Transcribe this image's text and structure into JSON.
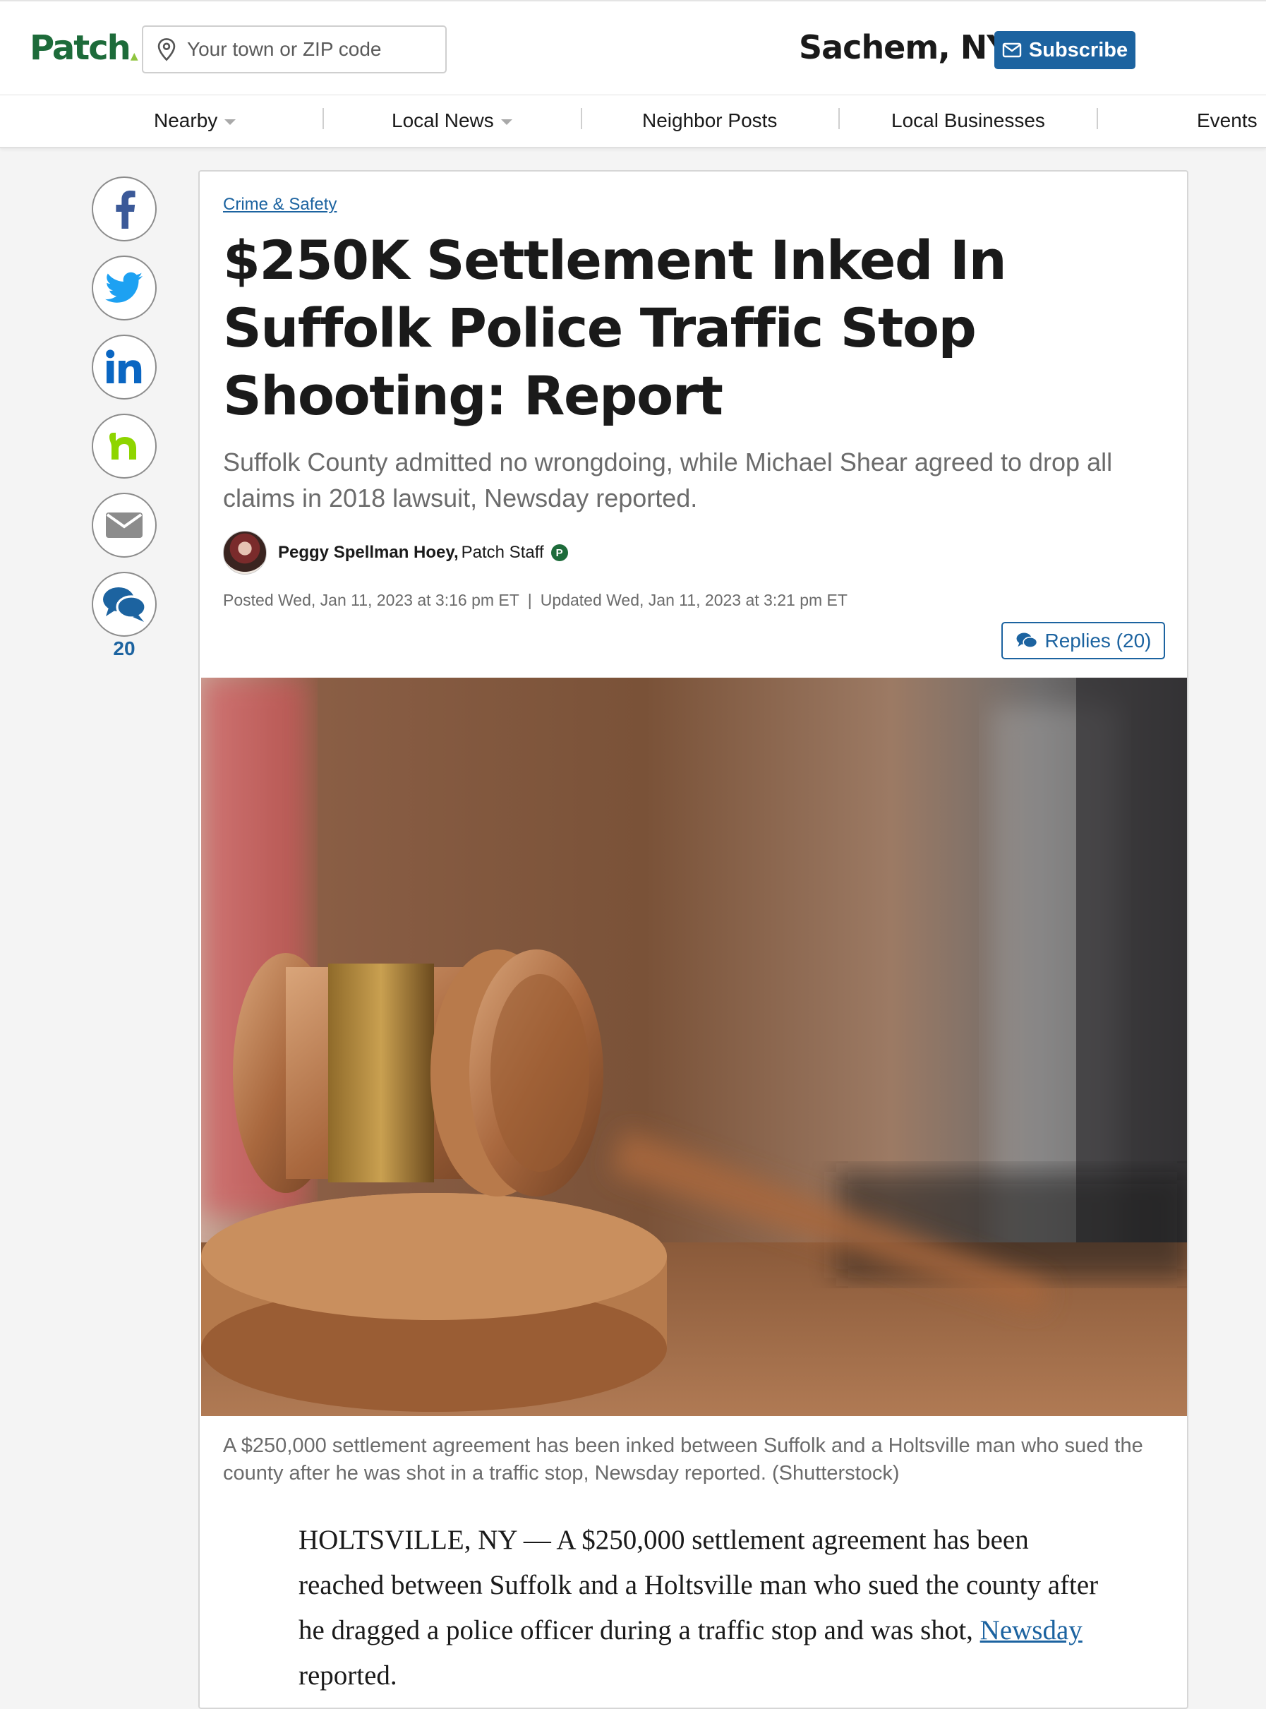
{
  "header": {
    "logo": "Patch",
    "search_placeholder": "Your town or ZIP code",
    "town": "Sachem, NY",
    "subscribe_label": "Subscribe"
  },
  "nav": {
    "items": [
      {
        "label": "Nearby",
        "dropdown": true
      },
      {
        "label": "Local News",
        "dropdown": true
      },
      {
        "label": "Neighbor Posts",
        "dropdown": false
      },
      {
        "label": "Local Businesses",
        "dropdown": false
      },
      {
        "label": "Events",
        "dropdown": false
      }
    ]
  },
  "share": {
    "icons": [
      "facebook-icon",
      "twitter-icon",
      "linkedin-icon",
      "nextdoor-icon",
      "email-icon",
      "comments-icon"
    ],
    "reply_count": "20"
  },
  "article": {
    "category": "Crime & Safety",
    "headline": "$250K Settlement Inked In Suffolk Police Traffic Stop Shooting: Report",
    "dek": "Suffolk County admitted no wrongdoing, while Michael Shear agreed to drop all claims in 2018 lawsuit, Newsday reported.",
    "author": "Peggy Spellman Hoey,",
    "author_role": "Patch Staff",
    "patch_badge": "P",
    "posted": "Posted Wed, Jan 11, 2023 at 3:16 pm ET",
    "date_separator": "|",
    "updated": "Updated Wed, Jan 11, 2023 at 3:21 pm ET",
    "replies_label": "Replies (20)",
    "caption": "A $250,000 settlement agreement has been inked between Suffolk and a Holtsville man who sued the county after he was shot in a traffic stop, Newsday reported. (Shutterstock)",
    "body_lead": "HOLTSVILLE, NY — A $250,000 settlement agreement has been reached between Suffolk and a Holtsville man who sued the county after he dragged a police officer during a traffic stop and was shot, ",
    "body_link": "Newsday",
    "body_tail": " reported."
  },
  "colors": {
    "brand_green": "#1d6b3a",
    "link_blue": "#1c63a0",
    "muted_text": "#6b6b6b"
  }
}
